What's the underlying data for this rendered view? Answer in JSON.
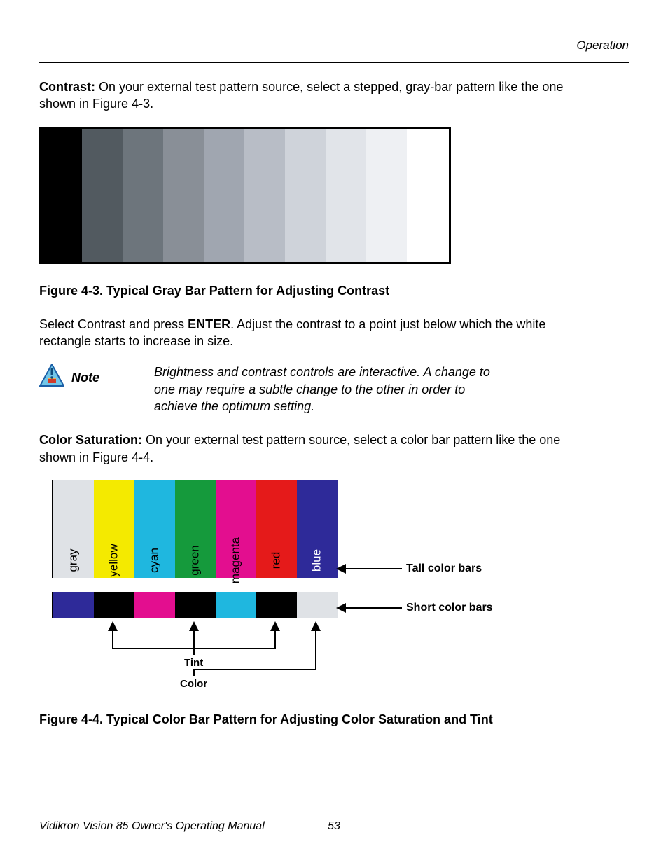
{
  "header": {
    "section": "Operation"
  },
  "p1": {
    "lead": "Contrast: ",
    "rest": "On your external test pattern source, select a stepped, gray-bar pattern like the one shown in Figure 4-3."
  },
  "graybars": [
    {
      "c": "#000000"
    },
    {
      "c": "#525a60"
    },
    {
      "c": "#6d757c"
    },
    {
      "c": "#898f97"
    },
    {
      "c": "#a0a6b0"
    },
    {
      "c": "#b8bdc6"
    },
    {
      "c": "#cfd3da"
    },
    {
      "c": "#e1e4e9"
    },
    {
      "c": "#eef0f3"
    },
    {
      "c": "#ffffff"
    }
  ],
  "fig43": "Figure 4-3. Typical Gray Bar Pattern for Adjusting Contrast",
  "p2_pre": "Select Contrast and press ",
  "p2_enter": "ENTER",
  "p2_post": ". Adjust the contrast to a point just below which the white rectangle starts to increase in size.",
  "note": {
    "label": "Note",
    "text": "Brightness and contrast controls are interactive. A change to one may require a subtle change to the other in order to achieve the optimum setting."
  },
  "p3": {
    "lead": "Color Saturation: ",
    "rest": "On your external test pattern source, select a color bar pattern like the one shown in Figure 4-4."
  },
  "tallbars": [
    {
      "c": "#dfe2e6",
      "label": "gray",
      "fg": "#000"
    },
    {
      "c": "#f4ea00",
      "label": "yellow",
      "fg": "#000"
    },
    {
      "c": "#1fb7df",
      "label": "cyan",
      "fg": "#000"
    },
    {
      "c": "#159a3c",
      "label": "green",
      "fg": "#000"
    },
    {
      "c": "#e30e8f",
      "label": "magenta",
      "fg": "#000"
    },
    {
      "c": "#e51a1a",
      "label": "red",
      "fg": "#000"
    },
    {
      "c": "#2e2a99",
      "label": "blue",
      "fg": "#fff"
    }
  ],
  "shortbars": [
    {
      "c": "#2e2a99"
    },
    {
      "c": "#000000"
    },
    {
      "c": "#e30e8f"
    },
    {
      "c": "#000000"
    },
    {
      "c": "#1fb7df"
    },
    {
      "c": "#000000"
    },
    {
      "c": "#dfe2e6"
    }
  ],
  "callouts": {
    "tall": "Tall color bars",
    "short": "Short color bars",
    "tint": "Tint",
    "color": "Color"
  },
  "fig44": "Figure 4-4. Typical Color Bar Pattern for Adjusting Color Saturation and Tint",
  "footer": {
    "left": "Vidikron Vision 85 Owner's Operating Manual",
    "page": "53"
  }
}
